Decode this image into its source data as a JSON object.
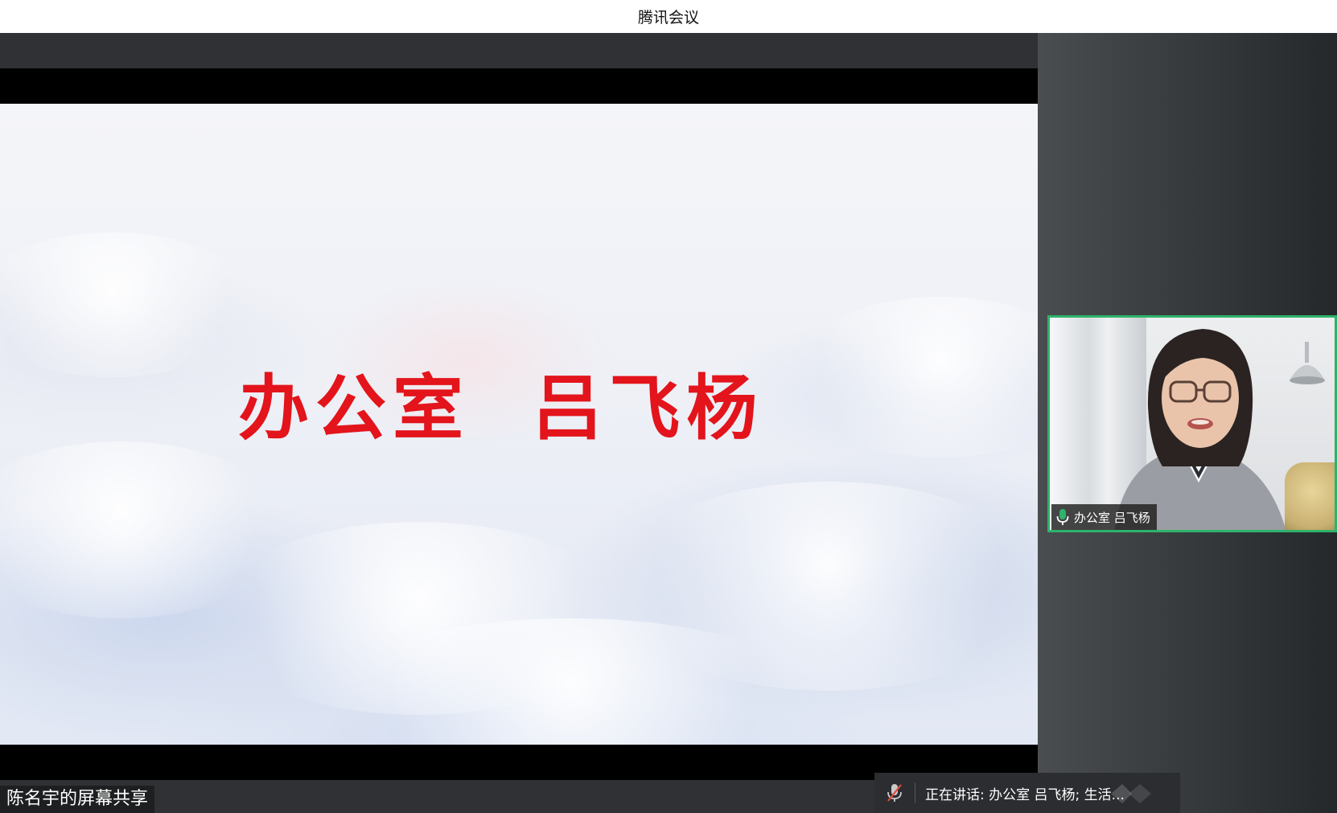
{
  "app": {
    "title": "腾讯会议"
  },
  "share": {
    "slide_title": "办公室  吕飞杨",
    "label": "陈名宇的屏幕共享"
  },
  "participant": {
    "name": "办公室 吕飞杨",
    "mic_icon": "mic-active-icon"
  },
  "status": {
    "speaking_text": "正在讲话: 办公室 吕飞杨; 生活...",
    "mic_icon": "mic-muted-icon"
  },
  "colors": {
    "title_bar_bg": "#ffffff",
    "slide_text": "#e3141b",
    "active_speaker_border": "#2eb36b",
    "mic_active": "#2eb36b"
  }
}
